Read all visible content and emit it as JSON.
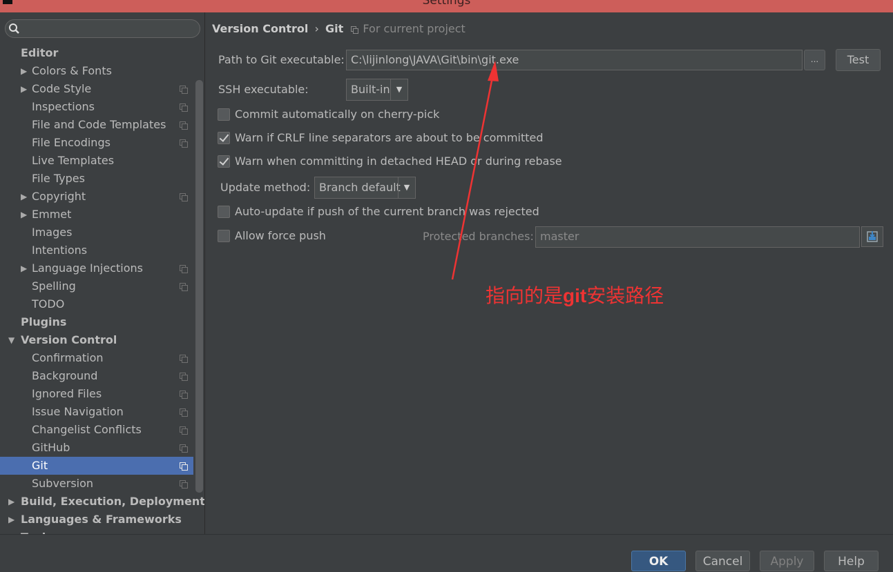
{
  "window": {
    "title": "Settings"
  },
  "sidebar": {
    "search_value": "",
    "items": [
      {
        "label": "Editor",
        "kind": "group",
        "arrow": "",
        "proj": false
      },
      {
        "label": "Colors & Fonts",
        "kind": "child",
        "arrow": "▶",
        "proj": false
      },
      {
        "label": "Code Style",
        "kind": "child",
        "arrow": "▶",
        "proj": true
      },
      {
        "label": "Inspections",
        "kind": "child",
        "arrow": "",
        "proj": true
      },
      {
        "label": "File and Code Templates",
        "kind": "child",
        "arrow": "",
        "proj": true
      },
      {
        "label": "File Encodings",
        "kind": "child",
        "arrow": "",
        "proj": true
      },
      {
        "label": "Live Templates",
        "kind": "child",
        "arrow": "",
        "proj": false
      },
      {
        "label": "File Types",
        "kind": "child",
        "arrow": "",
        "proj": false
      },
      {
        "label": "Copyright",
        "kind": "child",
        "arrow": "▶",
        "proj": true
      },
      {
        "label": "Emmet",
        "kind": "child",
        "arrow": "▶",
        "proj": false
      },
      {
        "label": "Images",
        "kind": "child",
        "arrow": "",
        "proj": false
      },
      {
        "label": "Intentions",
        "kind": "child",
        "arrow": "",
        "proj": false
      },
      {
        "label": "Language Injections",
        "kind": "child",
        "arrow": "▶",
        "proj": true
      },
      {
        "label": "Spelling",
        "kind": "child",
        "arrow": "",
        "proj": true
      },
      {
        "label": "TODO",
        "kind": "child",
        "arrow": "",
        "proj": false
      },
      {
        "label": "Plugins",
        "kind": "group",
        "arrow": "",
        "proj": false
      },
      {
        "label": "Version Control",
        "kind": "group",
        "arrow": "▼",
        "proj": false
      },
      {
        "label": "Confirmation",
        "kind": "child",
        "arrow": "",
        "proj": true
      },
      {
        "label": "Background",
        "kind": "child",
        "arrow": "",
        "proj": true
      },
      {
        "label": "Ignored Files",
        "kind": "child",
        "arrow": "",
        "proj": true
      },
      {
        "label": "Issue Navigation",
        "kind": "child",
        "arrow": "",
        "proj": true
      },
      {
        "label": "Changelist Conflicts",
        "kind": "child",
        "arrow": "",
        "proj": true
      },
      {
        "label": "GitHub",
        "kind": "child",
        "arrow": "",
        "proj": true
      },
      {
        "label": "Git",
        "kind": "child",
        "arrow": "",
        "proj": true,
        "selected": true
      },
      {
        "label": "Subversion",
        "kind": "child",
        "arrow": "",
        "proj": true
      },
      {
        "label": "Build, Execution, Deployment",
        "kind": "group",
        "arrow": "▶",
        "proj": false
      },
      {
        "label": "Languages & Frameworks",
        "kind": "group",
        "arrow": "▶",
        "proj": false
      },
      {
        "label": "Tools",
        "kind": "group",
        "arrow": "▶",
        "proj": false
      }
    ]
  },
  "breadcrumb": {
    "parent": "Version Control",
    "separator": "›",
    "current": "Git",
    "scope": "For current project"
  },
  "git": {
    "path_label": "Path to Git executable:",
    "path_value": "C:\\lijinlong\\JAVA\\Git\\bin\\git.exe",
    "browse_label": "...",
    "test_label": "Test",
    "ssh_label": "SSH executable:",
    "ssh_value": "Built-in",
    "cherry_pick_label": "Commit automatically on cherry-pick",
    "cherry_pick_checked": false,
    "crlf_label": "Warn if CRLF line separators are about to be committed",
    "crlf_checked": true,
    "detached_label": "Warn when committing in detached HEAD or during rebase",
    "detached_checked": true,
    "update_method_label": "Update method:",
    "update_method_value": "Branch default",
    "auto_update_label": "Auto-update if push of the current branch was rejected",
    "auto_update_checked": false,
    "force_push_label": "Allow force push",
    "force_push_checked": false,
    "protected_label": "Protected branches:",
    "protected_value": "master"
  },
  "annotation": {
    "text_before": "指向的是",
    "text_bold": "git",
    "text_after": "安装路径",
    "color": "#ee3333"
  },
  "footer": {
    "ok_label": "OK",
    "cancel_label": "Cancel",
    "apply_label": "Apply",
    "help_label": "Help"
  },
  "colors": {
    "titlebar": "#cd5e5a",
    "background": "#3c3f41",
    "selection": "#4b6eaf",
    "primary_button": "#365880"
  }
}
